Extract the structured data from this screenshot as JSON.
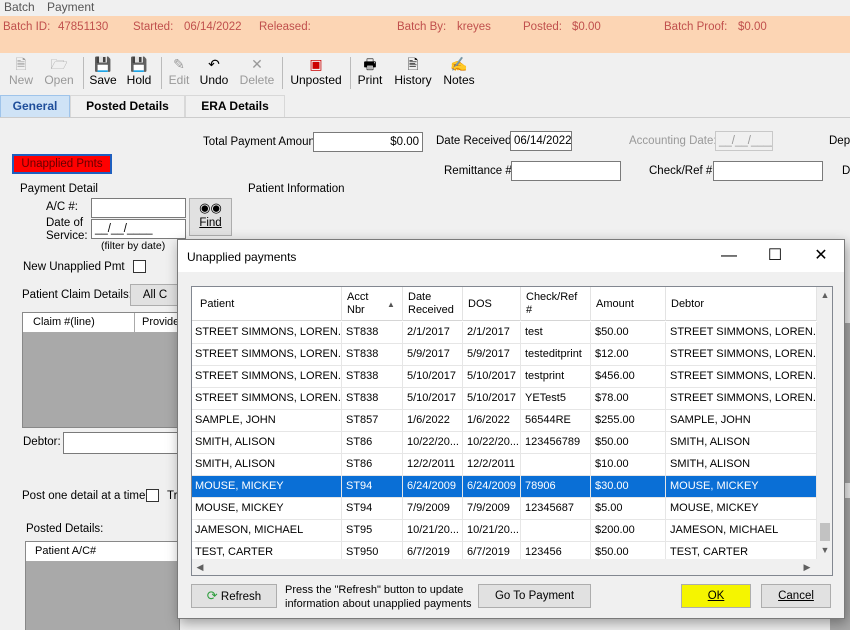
{
  "menu": {
    "batch": "Batch",
    "payment": "Payment"
  },
  "batch": {
    "id_label": "Batch ID:",
    "id_value": "47851130",
    "started_label": "Started:",
    "started_value": "06/14/2022",
    "released_label": "Released:",
    "batch_by_label": "Batch By:",
    "batch_by_value": "kreyes",
    "posted_label": "Posted:",
    "posted_value": "$0.00",
    "proof_label": "Batch Proof:",
    "proof_value": "$0.00"
  },
  "toolbar": {
    "new": "New",
    "open": "Open",
    "save": "Save",
    "hold": "Hold",
    "edit": "Edit",
    "undo": "Undo",
    "delete": "Delete",
    "unposted": "Unposted",
    "print": "Print",
    "history": "History",
    "notes": "Notes"
  },
  "tabs": {
    "general": "General",
    "posted_details": "Posted Details",
    "era_details": "ERA Details"
  },
  "form": {
    "total_payment_label": "Total Payment Amount:",
    "total_payment_value": "$0.00",
    "date_received_label": "Date Received:",
    "date_received_value": "06/14/2022",
    "accounting_date_label": "Accounting Date:",
    "accounting_date_value": "__/__/____",
    "dep_label": "Dep",
    "unapplied_btn": "Unapplied Pmts",
    "remittance_label": "Remittance #:",
    "check_ref_label": "Check/Ref #:",
    "d_label": "D",
    "payment_detail_label": "Payment Detail",
    "patient_info_label": "Patient Information",
    "ac_label": "A/C #:",
    "dos_label_1": "Date of",
    "dos_label_2": "Service:",
    "dos_value": "__/__/____",
    "filter_note": "(filter by date)",
    "find_btn": "Find",
    "new_unapplied_label": "New Unapplied Pmt",
    "claim_details_label": "Patient Claim Details:",
    "all_btn": "All C",
    "claim_col": "Claim #(line)",
    "provider_col": "Provide",
    "debtor_label": "Debtor:",
    "post_one_label": "Post one detail at a time:",
    "tr_label": "Tr",
    "posted_details_label": "Posted Details:",
    "patient_ac_col": "Patient A/C#"
  },
  "dialog": {
    "title": "Unapplied payments",
    "columns": [
      "Patient",
      "Acct Nbr",
      "Date Received",
      "DOS",
      "Check/Ref #",
      "Amount",
      "Debtor"
    ],
    "rows": [
      {
        "patient": "STREET SIMMONS, LOREN...",
        "acct": "ST838",
        "received": "2/1/2017",
        "dos": "2/1/2017",
        "ref": "test",
        "amount": "$50.00",
        "debtor": "STREET SIMMONS, LOREN..."
      },
      {
        "patient": "STREET SIMMONS, LOREN...",
        "acct": "ST838",
        "received": "5/9/2017",
        "dos": "5/9/2017",
        "ref": "testeditprint",
        "amount": "$12.00",
        "debtor": "STREET SIMMONS, LOREN..."
      },
      {
        "patient": "STREET SIMMONS, LOREN...",
        "acct": "ST838",
        "received": "5/10/2017",
        "dos": "5/10/2017",
        "ref": "testprint",
        "amount": "$456.00",
        "debtor": "STREET SIMMONS, LOREN..."
      },
      {
        "patient": "STREET SIMMONS, LOREN...",
        "acct": "ST838",
        "received": "5/10/2017",
        "dos": "5/10/2017",
        "ref": "YETest5",
        "amount": "$78.00",
        "debtor": "STREET SIMMONS, LOREN..."
      },
      {
        "patient": "SAMPLE, JOHN",
        "acct": "ST857",
        "received": "1/6/2022",
        "dos": "1/6/2022",
        "ref": "56544RE",
        "amount": "$255.00",
        "debtor": "SAMPLE, JOHN"
      },
      {
        "patient": "SMITH, ALISON",
        "acct": "ST86",
        "received": "10/22/20...",
        "dos": "10/22/20...",
        "ref": "123456789",
        "amount": "$50.00",
        "debtor": "SMITH, ALISON"
      },
      {
        "patient": "SMITH, ALISON",
        "acct": "ST86",
        "received": "12/2/2011",
        "dos": "12/2/2011",
        "ref": "",
        "amount": "$10.00",
        "debtor": "SMITH, ALISON"
      },
      {
        "patient": "MOUSE, MICKEY",
        "acct": "ST94",
        "received": "6/24/2009",
        "dos": "6/24/2009",
        "ref": "78906",
        "amount": "$30.00",
        "debtor": "MOUSE, MICKEY"
      },
      {
        "patient": "MOUSE, MICKEY",
        "acct": "ST94",
        "received": "7/9/2009",
        "dos": "7/9/2009",
        "ref": "12345687",
        "amount": "$5.00",
        "debtor": "MOUSE, MICKEY"
      },
      {
        "patient": "JAMESON, MICHAEL",
        "acct": "ST95",
        "received": "10/21/20...",
        "dos": "10/21/20...",
        "ref": "",
        "amount": "$200.00",
        "debtor": "JAMESON, MICHAEL"
      },
      {
        "patient": "TEST, CARTER",
        "acct": "ST950",
        "received": "6/7/2019",
        "dos": "6/7/2019",
        "ref": "123456",
        "amount": "$50.00",
        "debtor": "TEST, CARTER"
      }
    ],
    "selected_row": 7,
    "refresh_btn": "Refresh",
    "refresh_note_1": "Press the \"Refresh\" button to update",
    "refresh_note_2": "information about unapplied payments",
    "goto_btn": "Go To Payment",
    "ok_btn": "OK",
    "cancel_btn": "Cancel"
  },
  "colors": {
    "batch_bar": "#fcd5b4",
    "batch_text": "#c0504d",
    "selection": "#0a6fd6",
    "ok_highlight": "#f5f500",
    "unapplied_btn": "#ff0000"
  }
}
